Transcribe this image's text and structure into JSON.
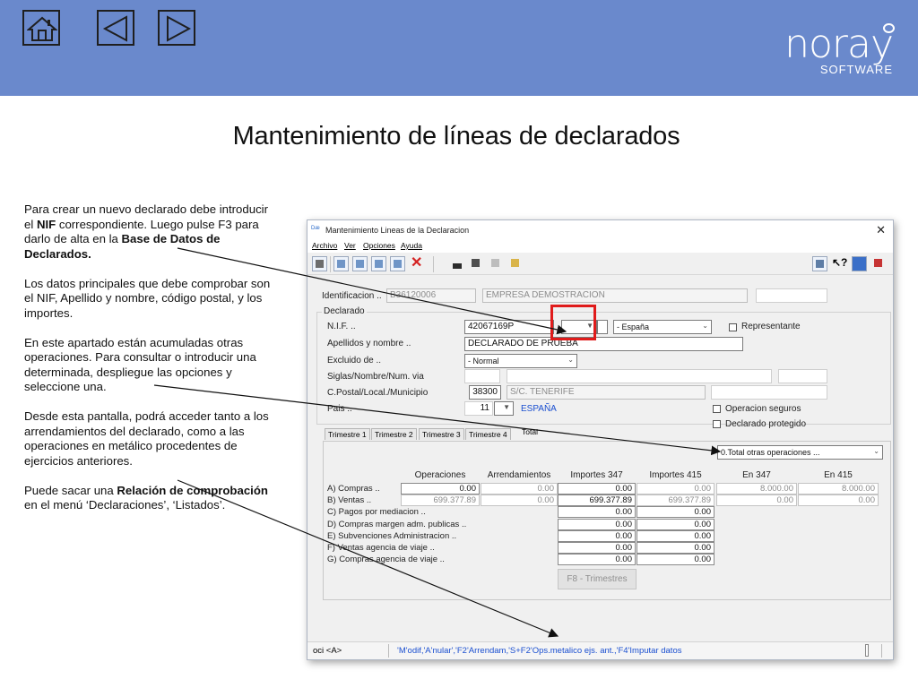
{
  "slide": {
    "title": "Mantenimiento de líneas de declarados",
    "brand": {
      "name": "noray",
      "sub": "SOFTWARE"
    },
    "colors": {
      "header_bg": "#6a89cc",
      "highlight": "#e01b1b"
    },
    "nav": [
      {
        "icon": "home-icon",
        "label": "home"
      },
      {
        "icon": "back-arrow-icon",
        "label": "previous"
      },
      {
        "icon": "forward-arrow-icon",
        "label": "next"
      }
    ],
    "paragraphs": [
      [
        {
          "t": "Para crear un nuevo declarado debe introducir el "
        },
        {
          "t": "NIF",
          "b": true
        },
        {
          "t": " correspondiente. Luego pulse F3 para darlo de alta en la "
        },
        {
          "t": "Base de Datos de Declarados.",
          "b": true
        }
      ],
      [
        {
          "t": "Los datos principales que debe comprobar son el NIF, Apellido y nombre, código postal, y los importes."
        }
      ],
      [
        {
          "t": "En este apartado están acumuladas otras operaciones. Para consultar o introducir una determinada, despliegue las opciones y seleccione una."
        }
      ],
      [
        {
          "t": "Desde esta pantalla, podrá acceder tanto a los arrendamientos del declarado, como a las operaciones en metálico procedentes de ejercicios anteriores."
        }
      ],
      [
        {
          "t": "Puede sacar una "
        },
        {
          "t": "Relación de comprobación",
          "b": true
        },
        {
          "t": " en el menú ‘Declaraciones’, ‘Listados’."
        }
      ]
    ]
  },
  "window": {
    "app_icon": "Dæ",
    "title": "Mantenimiento Lineas de la Declaracion",
    "close": "✕",
    "menu": [
      "Archivo",
      "Ver",
      "Opciones",
      "Ayuda"
    ],
    "identificacion": {
      "label": "Identificacion ..",
      "nif": "B36120006",
      "empresa": "EMPRESA DEMOSTRACION"
    },
    "declarado": {
      "group_title": "Declarado",
      "nif_label": "N.I.F. ..",
      "nif_value": "42067169P",
      "pais_combo": "- España",
      "representante_label": "Representante",
      "apellidos_label": "Apellidos y nombre ..",
      "apellidos_value": "DECLARADO DE PRUEBA",
      "excluido_label": "Excluido de ..",
      "excluido_value": "- Normal",
      "siglas_label": "Siglas/Nombre/Num. via",
      "cp_label": "C.Postal/Local./Municipio",
      "cp_value": "38300",
      "localidad_value": "S/C. TENERIFE",
      "pais_label": "Pais ..",
      "pais_code": "11",
      "pais_name": "ESPAÑA",
      "op_seguros_label": "Operacion seguros",
      "protegido_label": "Declarado protegido"
    },
    "tabs": [
      "Trimestre 1",
      "Trimestre 2",
      "Trimestre 3",
      "Trimestre 4",
      "Total"
    ],
    "otras_operaciones": "0.Total otras operaciones ...",
    "grid": {
      "headers": [
        "Operaciones",
        "Arrendamientos",
        "Importes 347",
        "Importes 415",
        "En 347",
        "En 415"
      ],
      "rows": [
        {
          "label": "A) Compras ..",
          "operaciones": "0.00",
          "arrendamientos": "0.00",
          "imp347": "0.00",
          "imp415": "0.00",
          "en347": "8.000.00",
          "en415": "8.000.00"
        },
        {
          "label": "B) Ventas ..",
          "operaciones": "699.377.89",
          "arrendamientos": "0.00",
          "imp347": "699.377.89",
          "imp415": "699.377.89",
          "en347": "0.00",
          "en415": "0.00"
        },
        {
          "label": "C) Pagos por mediacion ..",
          "imp347": "0.00",
          "imp415": "0.00"
        },
        {
          "label": "D) Compras margen adm. publicas ..",
          "imp347": "0.00",
          "imp415": "0.00"
        },
        {
          "label": "E) Subvenciones Administracion ..",
          "imp347": "0.00",
          "imp415": "0.00"
        },
        {
          "label": "F) Ventas agencia de viaje ..",
          "imp347": "0.00",
          "imp415": "0.00"
        },
        {
          "label": "G) Compras agencia de viaje ..",
          "imp347": "0.00",
          "imp415": "0.00"
        }
      ]
    },
    "f8_button": "F8 - Trimestres",
    "status": {
      "left": "oci <A>",
      "hint": "'M'odif,'A'nular','F2'Arrendam,'S+F2'Ops.metalico ejs. ant.,'F4'Imputar datos"
    }
  }
}
